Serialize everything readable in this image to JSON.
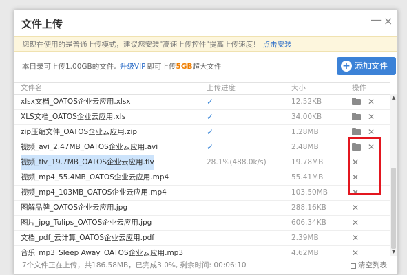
{
  "dialog": {
    "title": "文件上传",
    "minimize_glyph": "—",
    "close_glyph": "×"
  },
  "notice": {
    "text": "您现在使用的是普通上传模式，建议您安装\"高速上传控件\"提高上传速度！",
    "link": "点击安装"
  },
  "quota": {
    "prefix": "本目录可上传1.00GB的文件,",
    "vip": "升级VIP",
    "middle": "即可上传",
    "big": "5GB",
    "suffix": "超大文件"
  },
  "add_button": {
    "icon": "plus-icon",
    "label": "添加文件"
  },
  "table": {
    "headers": {
      "name": "文件名",
      "progress": "上传进度",
      "size": "大小",
      "ops": "操作"
    },
    "rows": [
      {
        "name": "xlsx文档_OATOS企业云应用.xlsx",
        "progress": "✓",
        "size": "12.52KB",
        "ops": [
          "folder-icon",
          "close-icon"
        ]
      },
      {
        "name": "XLS文档_OATOS企业云应用.xls",
        "progress": "✓",
        "size": "34.00KB",
        "ops": [
          "folder-icon",
          "close-icon"
        ]
      },
      {
        "name": "zip压缩文件_OATOS企业云应用.zip",
        "progress": "✓",
        "size": "1.28MB",
        "ops": [
          "folder-icon",
          "close-icon"
        ]
      },
      {
        "name": "视频_avi_2.47MB_OATOS企业云应用.avi",
        "progress": "✓",
        "size": "2.48MB",
        "ops": [
          "folder-icon",
          "close-icon"
        ]
      },
      {
        "name": "视频_flv_19.7MB_OATOS企业云应用.flv",
        "progress": "28.1%(488.0k/s)",
        "size": "19.78MB",
        "ops": [
          "close-icon"
        ]
      },
      {
        "name": "视频_mp4_55.4MB_OATOS企业云应用.mp4",
        "progress": "",
        "size": "55.41MB",
        "ops": [
          "close-icon"
        ]
      },
      {
        "name": "视频_mp4_103MB_OATOS企业云应用.mp4",
        "progress": "",
        "size": "103.50MB",
        "ops": [
          "close-icon"
        ]
      },
      {
        "name": "图解品牌_OATOS企业云应用.jpg",
        "progress": "",
        "size": "288.16KB",
        "ops": [
          "close-icon"
        ]
      },
      {
        "name": "图片_jpg_Tulips_OATOS企业云应用.jpg",
        "progress": "",
        "size": "606.34KB",
        "ops": [
          "close-icon"
        ]
      },
      {
        "name": "文档_pdf_云计算_OATOS企业云应用.pdf",
        "progress": "",
        "size": "2.39MB",
        "ops": [
          "close-icon"
        ]
      },
      {
        "name": "音乐_mp3_Sleep Away_OATOS企业云应用.mp3",
        "progress": "",
        "size": "4.62MB",
        "ops": [
          "close-icon"
        ]
      }
    ]
  },
  "footer": {
    "status": "7个文件正在上传，共186.58MB，已完成3.0%, 剩余时间: 00:06:10",
    "clear": "清空列表"
  },
  "colors": {
    "accent": "#3c82d7",
    "highlight": "#e3161f",
    "notice_bg": "#fdf6dd"
  }
}
